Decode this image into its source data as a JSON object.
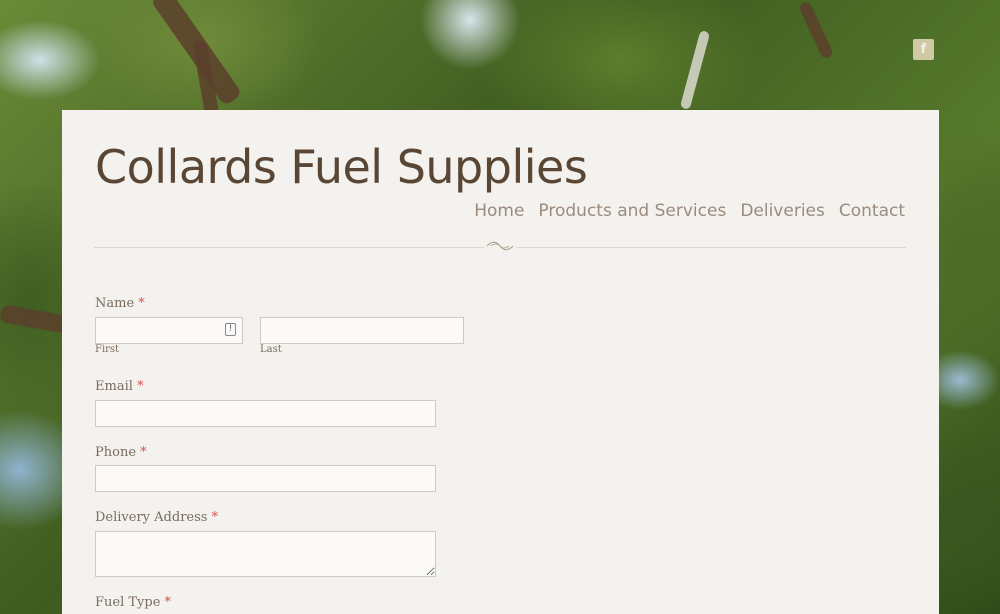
{
  "site": {
    "title": "Collards Fuel Supplies"
  },
  "nav": {
    "items": [
      "Home",
      "Products and Services",
      "Deliveries",
      "Contact"
    ]
  },
  "social": {
    "facebook_glyph": "f"
  },
  "form": {
    "required_marker": "*",
    "name": {
      "label": "Name",
      "first_sub": "First",
      "last_sub": "Last",
      "first_value": "",
      "last_value": ""
    },
    "email": {
      "label": "Email",
      "value": ""
    },
    "phone": {
      "label": "Phone",
      "value": ""
    },
    "address": {
      "label": "Delivery Address",
      "value": ""
    },
    "fuel": {
      "label": "Fuel Type"
    }
  },
  "colors": {
    "title": "#5a4634",
    "nav": "#9a8b7e",
    "required": "#d9534f",
    "panel": "#f4f2ee"
  },
  "icons": {
    "facebook": "facebook-icon",
    "contact_card": "contact-card-icon",
    "ornament": "flourish-ornament-icon"
  }
}
